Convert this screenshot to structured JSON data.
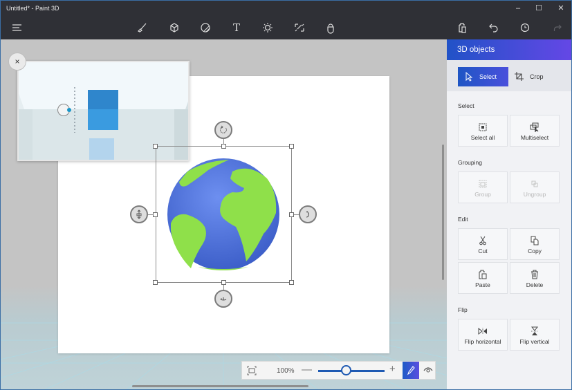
{
  "window": {
    "title": "Untitled* - Paint 3D",
    "minimize_glyph": "–",
    "maximize_glyph": "☐",
    "close_glyph": "✕"
  },
  "toolbar": {
    "menu_icon": "hamburger-menu-icon",
    "tools": [
      {
        "name": "brushes",
        "icon": "brush-icon"
      },
      {
        "name": "3d-shapes",
        "icon": "cube-icon"
      },
      {
        "name": "stickers",
        "icon": "sticker-icon"
      },
      {
        "name": "text",
        "icon": "text-icon",
        "glyph": "T"
      },
      {
        "name": "effects",
        "icon": "sun-icon"
      },
      {
        "name": "canvas",
        "icon": "canvas-resize-icon"
      },
      {
        "name": "3d-library",
        "icon": "library-icon"
      }
    ],
    "right": [
      {
        "name": "paste",
        "icon": "paste-icon"
      },
      {
        "name": "undo",
        "icon": "undo-icon"
      },
      {
        "name": "history",
        "icon": "history-icon"
      },
      {
        "name": "redo",
        "icon": "redo-icon",
        "disabled": true
      }
    ]
  },
  "canvas": {
    "preview_close_glyph": "×",
    "object": "globe",
    "colors": {
      "ocean": "#4f74d9",
      "land": "#8fe04a",
      "cube": "#3a9be0"
    }
  },
  "zoom_bar": {
    "zoom_percent_label": "100%",
    "zoom_value_percent": 100,
    "slider_position_fraction": 0.42,
    "minus_glyph": "—",
    "plus_glyph": "+",
    "pen_mode_active": true
  },
  "panel": {
    "title": "3D objects",
    "modes": [
      {
        "label": "Select",
        "icon": "cursor-icon",
        "active": true
      },
      {
        "label": "Crop",
        "icon": "crop-icon",
        "active": false
      }
    ],
    "sections": {
      "select": {
        "label": "Select",
        "tiles": [
          {
            "label": "Select all",
            "icon": "select-all-icon"
          },
          {
            "label": "Multiselect",
            "icon": "multiselect-icon"
          }
        ]
      },
      "grouping": {
        "label": "Grouping",
        "tiles": [
          {
            "label": "Group",
            "icon": "group-icon",
            "disabled": true
          },
          {
            "label": "Ungroup",
            "icon": "ungroup-icon",
            "disabled": true
          }
        ]
      },
      "edit": {
        "label": "Edit",
        "tiles": [
          {
            "label": "Cut",
            "icon": "scissors-icon"
          },
          {
            "label": "Copy",
            "icon": "copy-icon"
          },
          {
            "label": "Paste",
            "icon": "paste-icon"
          },
          {
            "label": "Delete",
            "icon": "trash-icon"
          }
        ]
      },
      "flip": {
        "label": "Flip",
        "tiles": [
          {
            "label": "Flip horizontal",
            "icon": "flip-horizontal-icon"
          },
          {
            "label": "Flip vertical",
            "icon": "flip-vertical-icon"
          }
        ]
      }
    }
  }
}
